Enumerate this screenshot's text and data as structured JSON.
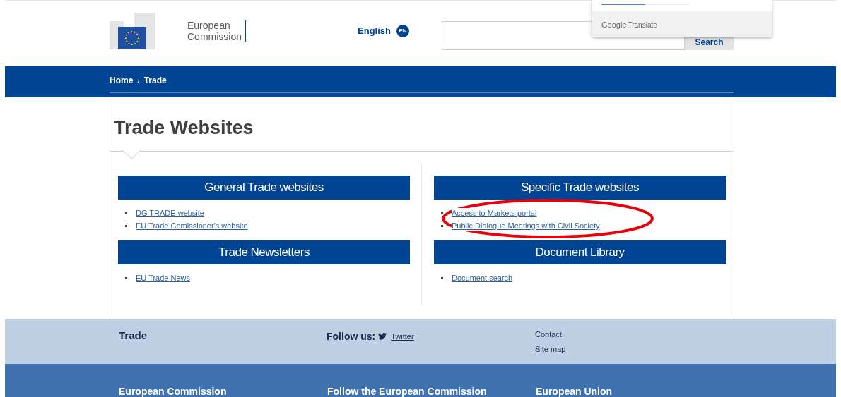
{
  "header": {
    "logo_text": [
      "European",
      "Commission"
    ],
    "language": {
      "label": "English",
      "code": "EN"
    },
    "search": {
      "button": "Search"
    }
  },
  "translate_popup": {
    "brand": "Google",
    "product": "Translate"
  },
  "breadcrumb": [
    "Home",
    "Trade"
  ],
  "breadcrumb_separator": "›",
  "page_title": "Trade Websites",
  "columns": [
    {
      "sections": [
        {
          "title": "General Trade websites",
          "links": [
            "DG TRADE website",
            "EU Trade Comissioner's website"
          ]
        },
        {
          "title": "Trade Newsletters",
          "links": [
            "EU Trade News"
          ]
        }
      ]
    },
    {
      "sections": [
        {
          "title": "Specific Trade websites",
          "links": [
            "Access to Markets portal",
            "Public Dialogue Meetings with Civil Society"
          ]
        },
        {
          "title": "Document Library",
          "links": [
            "Document search"
          ]
        }
      ]
    }
  ],
  "annotation": {
    "kind": "ellipse",
    "color": "#e8000b"
  },
  "footer": {
    "site_name": "Trade",
    "follow_label": "Follow us:",
    "social": "Twitter",
    "links": [
      "Contact",
      "Site map"
    ],
    "bottom_headings": [
      "European Commission",
      "Follow the European Commission",
      "European Union"
    ]
  }
}
